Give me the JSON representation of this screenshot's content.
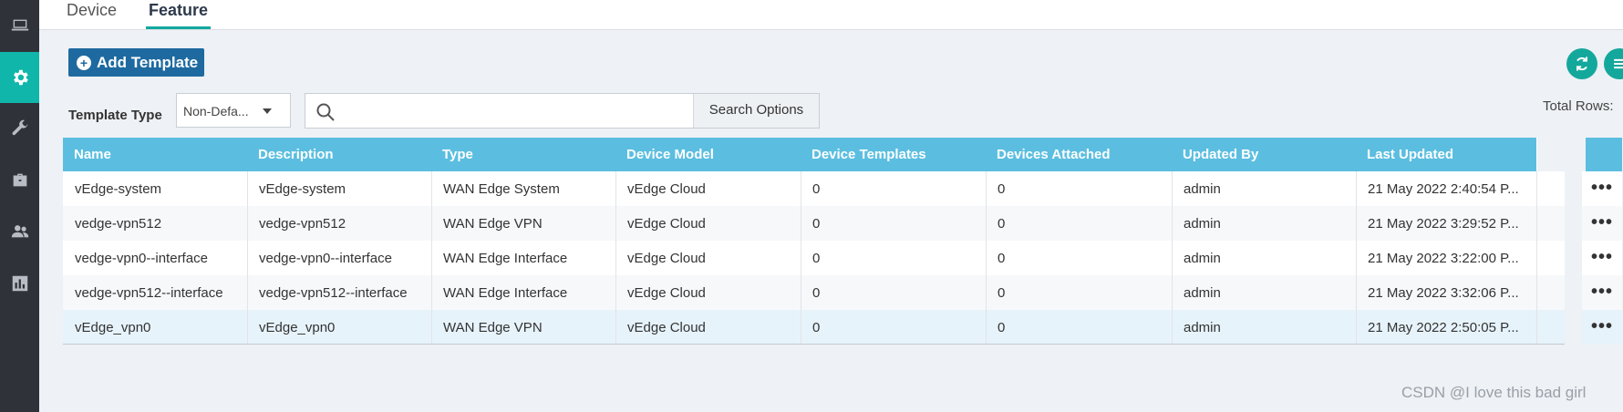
{
  "sidebar": {
    "items": [
      {
        "icon": "laptop-icon",
        "active": false
      },
      {
        "icon": "gear-icon",
        "active": true
      },
      {
        "icon": "wrench-icon",
        "active": false
      },
      {
        "icon": "briefcase-icon",
        "active": false
      },
      {
        "icon": "users-icon",
        "active": false
      },
      {
        "icon": "bar-chart-icon",
        "active": false
      }
    ]
  },
  "tabs": [
    {
      "label": "Device",
      "active": false
    },
    {
      "label": "Feature",
      "active": true
    }
  ],
  "toolbar": {
    "add_label": "Add Template",
    "refresh_icon": "refresh-icon",
    "menu_icon": "menu-icon"
  },
  "filter": {
    "type_label": "Template Type",
    "type_value": "Non-Defa...",
    "search_placeholder": "",
    "search_options_label": "Search Options",
    "total_rows_label": "Total Rows:"
  },
  "table": {
    "columns": [
      "Name",
      "Description",
      "Type",
      "Device Model",
      "Device Templates",
      "Devices Attached",
      "Updated By",
      "Last Updated"
    ],
    "rows": [
      [
        "vEdge-system",
        "vEdge-system",
        "WAN Edge System",
        "vEdge Cloud",
        "0",
        "0",
        "admin",
        "21 May 2022 2:40:54 P..."
      ],
      [
        "vedge-vpn512",
        "vedge-vpn512",
        "WAN Edge VPN",
        "vEdge Cloud",
        "0",
        "0",
        "admin",
        "21 May 2022 3:29:52 P..."
      ],
      [
        "vedge-vpn0--interface",
        "vedge-vpn0--interface",
        "WAN Edge Interface",
        "vEdge Cloud",
        "0",
        "0",
        "admin",
        "21 May 2022 3:22:00 P..."
      ],
      [
        "vedge-vpn512--interface",
        "vedge-vpn512--interface",
        "WAN Edge Interface",
        "vEdge Cloud",
        "0",
        "0",
        "admin",
        "21 May 2022 3:32:06 P..."
      ],
      [
        "vEdge_vpn0",
        "vEdge_vpn0",
        "WAN Edge VPN",
        "vEdge Cloud",
        "0",
        "0",
        "admin",
        "21 May 2022 2:50:05 P..."
      ]
    ],
    "row_action": "•••"
  },
  "watermark": "CSDN @I love this bad girl",
  "colors": {
    "accent": "#14a89c",
    "header_blue": "#5bbee0",
    "button_blue": "#1e6aa0",
    "sidebar": "#2f3238"
  }
}
